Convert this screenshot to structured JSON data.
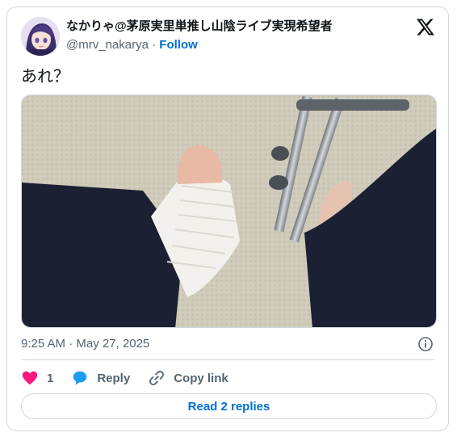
{
  "author": {
    "display_name": "なかりゃ@茅原実里単推し山陰ライブ実現希望者",
    "handle": "@mrv_nakarya",
    "separator": "·",
    "follow_label": "Follow"
  },
  "tweet": {
    "text": "あれ？",
    "timestamp": "9:25 AM · May 27, 2025"
  },
  "actions": {
    "like_count": "1",
    "reply_label": "Reply",
    "copy_link_label": "Copy link"
  },
  "read_replies_label": "Read 2 replies",
  "colors": {
    "link": "#006fd6",
    "like": "#f91880",
    "reply": "#1d9bf0",
    "muted": "#536471",
    "border": "#cfd9de"
  },
  "icons": [
    "avatar",
    "x-logo-icon",
    "info-icon",
    "heart-icon",
    "reply-bubble-icon",
    "link-icon"
  ]
}
